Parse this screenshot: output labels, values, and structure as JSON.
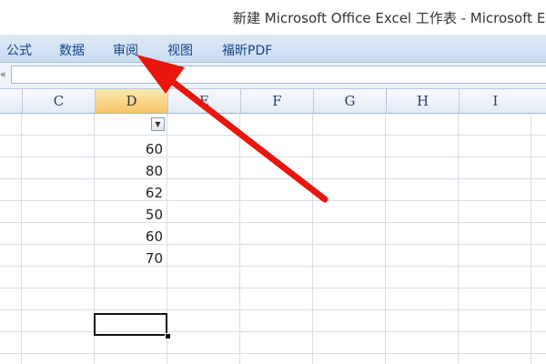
{
  "window": {
    "title": "新建 Microsoft Office Excel 工作表 - Microsoft E"
  },
  "ribbon": {
    "tabs": [
      {
        "label": "公式"
      },
      {
        "label": "数据"
      },
      {
        "label": "审阅"
      },
      {
        "label": "视图"
      },
      {
        "label": "福昕PDF"
      }
    ]
  },
  "columns": [
    "C",
    "D",
    "E",
    "F",
    "G",
    "H",
    "I"
  ],
  "active_column": "D",
  "cells": {
    "column_D": [
      "60",
      "80",
      "62",
      "50",
      "60",
      "70"
    ]
  },
  "colors": {
    "annotation_arrow": "#e8160c",
    "selection_border": "#111111",
    "active_header": "#f7c46a"
  },
  "icons": {
    "filter": "dropdown-arrow-icon"
  }
}
